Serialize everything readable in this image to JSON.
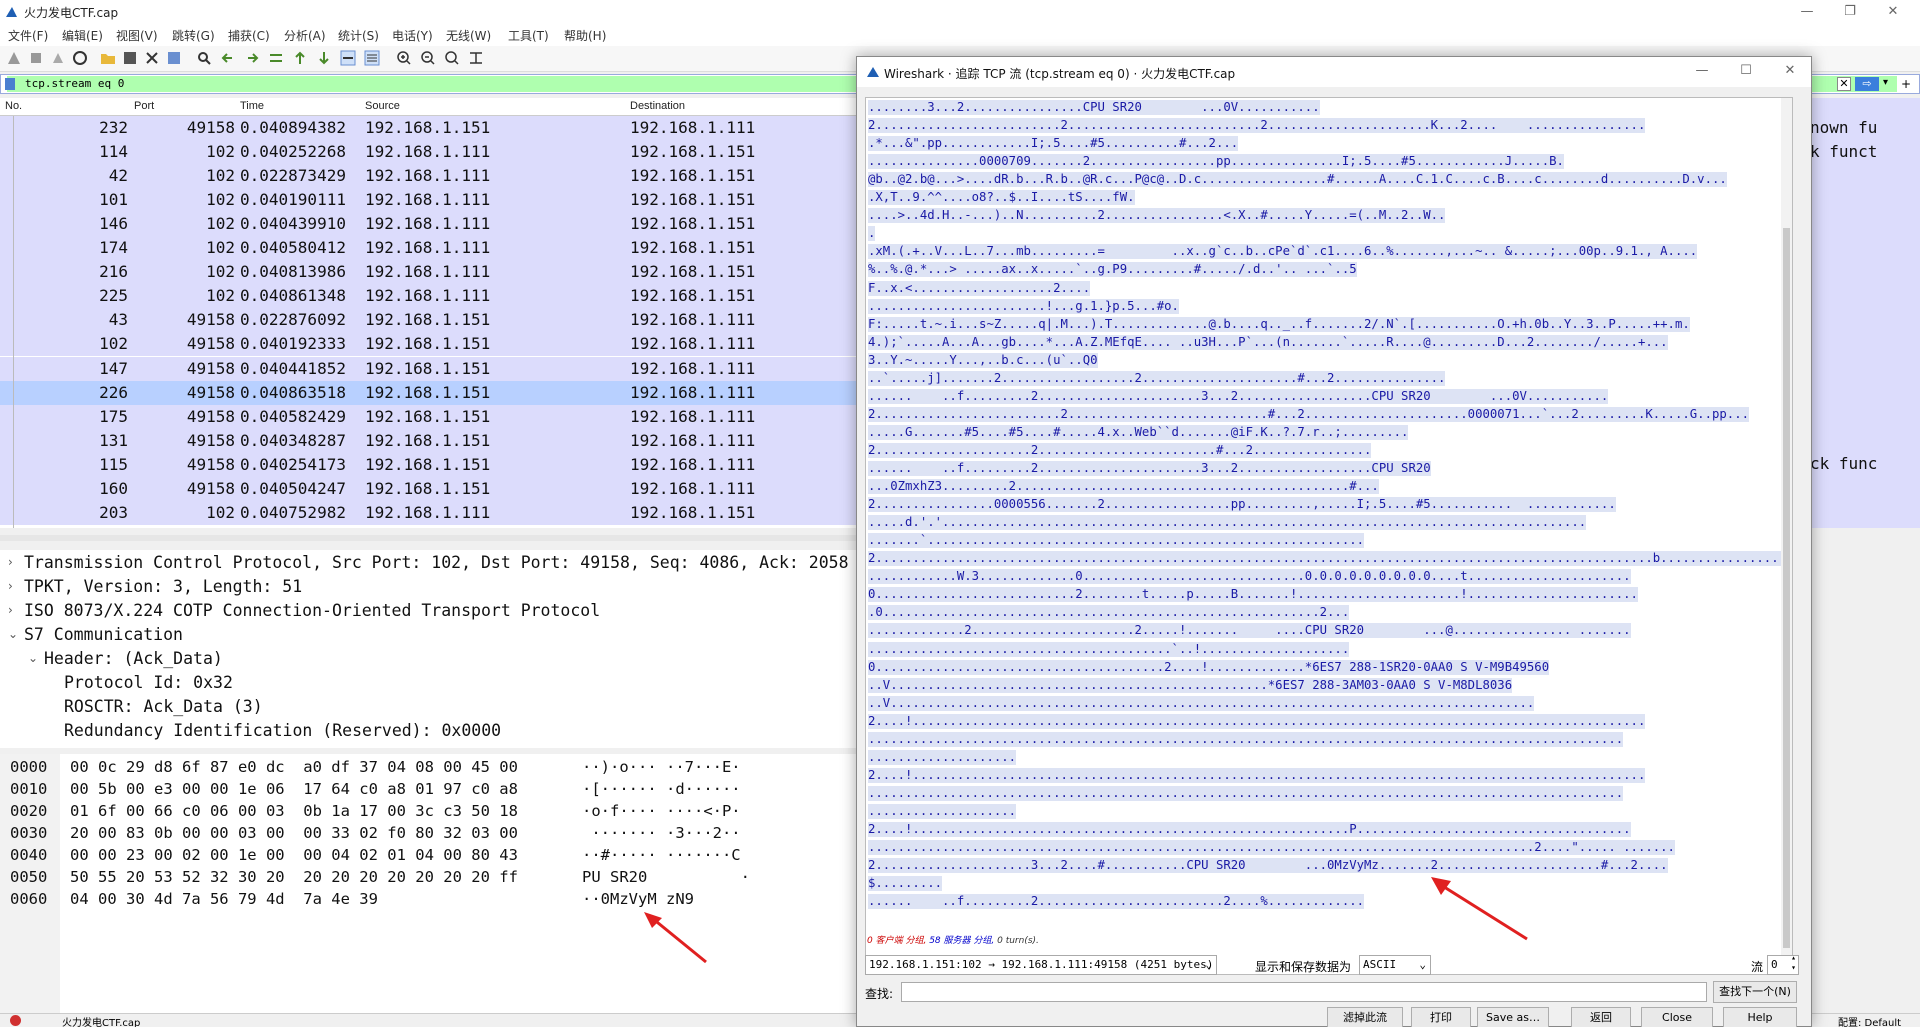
{
  "main_window": {
    "title": "火力发电CTF.cap",
    "menus": [
      "文件(F)",
      "编辑(E)",
      "视图(V)",
      "跳转(G)",
      "捕获(C)",
      "分析(A)",
      "统计(S)",
      "电话(Y)",
      "无线(W)",
      "工具(T)",
      "帮助(H)"
    ],
    "filter": "tcp.stream eq 0",
    "columns": [
      "No.",
      "Port",
      "Time",
      "Source",
      "Destination"
    ],
    "packets": [
      {
        "no": "232",
        "port": "49158",
        "time": "0.040894382",
        "src": "192.168.1.151",
        "dst": "192.168.1.111"
      },
      {
        "no": "114",
        "port": "102",
        "time": "0.040252268",
        "src": "192.168.1.111",
        "dst": "192.168.1.151"
      },
      {
        "no": "42",
        "port": "102",
        "time": "0.022873429",
        "src": "192.168.1.111",
        "dst": "192.168.1.151"
      },
      {
        "no": "101",
        "port": "102",
        "time": "0.040190111",
        "src": "192.168.1.111",
        "dst": "192.168.1.151"
      },
      {
        "no": "146",
        "port": "102",
        "time": "0.040439910",
        "src": "192.168.1.111",
        "dst": "192.168.1.151"
      },
      {
        "no": "174",
        "port": "102",
        "time": "0.040580412",
        "src": "192.168.1.111",
        "dst": "192.168.1.151"
      },
      {
        "no": "216",
        "port": "102",
        "time": "0.040813986",
        "src": "192.168.1.111",
        "dst": "192.168.1.151"
      },
      {
        "no": "225",
        "port": "102",
        "time": "0.040861348",
        "src": "192.168.1.111",
        "dst": "192.168.1.151"
      },
      {
        "no": "43",
        "port": "49158",
        "time": "0.022876092",
        "src": "192.168.1.151",
        "dst": "192.168.1.111"
      },
      {
        "no": "102",
        "port": "49158",
        "time": "0.040192333",
        "src": "192.168.1.151",
        "dst": "192.168.1.111"
      },
      {
        "no": "147",
        "port": "49158",
        "time": "0.040441852",
        "src": "192.168.1.151",
        "dst": "192.168.1.111"
      },
      {
        "no": "226",
        "port": "49158",
        "time": "0.040863518",
        "src": "192.168.1.151",
        "dst": "192.168.1.111"
      },
      {
        "no": "175",
        "port": "49158",
        "time": "0.040582429",
        "src": "192.168.1.151",
        "dst": "192.168.1.111"
      },
      {
        "no": "131",
        "port": "49158",
        "time": "0.040348287",
        "src": "192.168.1.151",
        "dst": "192.168.1.111"
      },
      {
        "no": "115",
        "port": "49158",
        "time": "0.040254173",
        "src": "192.168.1.151",
        "dst": "192.168.1.111"
      },
      {
        "no": "160",
        "port": "49158",
        "time": "0.040504247",
        "src": "192.168.1.151",
        "dst": "192.168.1.111"
      },
      {
        "no": "203",
        "port": "102",
        "time": "0.040752982",
        "src": "192.168.1.111",
        "dst": "192.168.1.151"
      }
    ],
    "selected_packet_index": 11,
    "right_fragments": [
      "nown fu",
      "k funct",
      "ck func"
    ],
    "details": [
      {
        "text": "Transmission Control Protocol, Src Port: 102, Dst Port: 49158, Seq: 4086, Ack: 2058",
        "indent": 0,
        "arrow": "›"
      },
      {
        "text": "TPKT, Version: 3, Length: 51",
        "indent": 0,
        "arrow": "›"
      },
      {
        "text": "ISO 8073/X.224 COTP Connection-Oriented Transport Protocol",
        "indent": 0,
        "arrow": "›"
      },
      {
        "text": "S7 Communication",
        "indent": 0,
        "arrow": "⌄"
      },
      {
        "text": "Header: (Ack_Data)",
        "indent": 1,
        "arrow": "⌄"
      },
      {
        "text": "Protocol Id: 0x32",
        "indent": 2,
        "arrow": ""
      },
      {
        "text": "ROSCTR: Ack_Data (3)",
        "indent": 2,
        "arrow": ""
      },
      {
        "text": "Redundancy Identification (Reserved): 0x0000",
        "indent": 2,
        "arrow": ""
      }
    ],
    "bytes": [
      {
        "offset": "0000",
        "hex": "00 0c 29 d8 6f 87 e0 dc  a0 df 37 04 08 00 45 00",
        "ascii": "··)·o··· ··7···E·"
      },
      {
        "offset": "0010",
        "hex": "00 5b 00 e3 00 00 1e 06  17 64 c0 a8 01 97 c0 a8",
        "ascii": "·[······ ·d······"
      },
      {
        "offset": "0020",
        "hex": "01 6f 00 66 c0 06 00 03  0b 1a 17 00 3c c3 50 18",
        "ascii": "·o·f···· ····<·P·"
      },
      {
        "offset": "0030",
        "hex": "20 00 83 0b 00 00 03 00  00 33 02 f0 80 32 03 00",
        "ascii": " ······· ·3···2··"
      },
      {
        "offset": "0040",
        "hex": "00 00 23 00 02 00 1e 00  00 04 02 01 04 00 80 43",
        "ascii": "··#····· ·······C"
      },
      {
        "offset": "0050",
        "hex": "50 55 20 53 52 32 30 20  20 20 20 20 20 20 20 ff",
        "ascii": "PU SR20          ·"
      },
      {
        "offset": "0060",
        "hex": "04 00 30 4d 7a 56 79 4d  7a 4e 39",
        "ascii": "··0MzVyM zN9"
      }
    ],
    "status_file": "火力发电CTF.cap",
    "status_profile": "配置: Default"
  },
  "dialog": {
    "title": "Wireshark · 追踪 TCP 流 (tcp.stream eq 0) · 火力发电CTF.cap",
    "stream_lines": [
      "........3...2................CPU SR20        ...0V...........",
      "2.........................2..........................2......................K...2....    ................",
      ".*...&\".pp............I;.5....#5..........#...2...",
      "...............0000709.......2.................pp...............I;.5....#5............J.....B.",
      "@b..@2.b@...>....dR.b...R.b..@R.c...P@c@..D.c.................#......A....C.1.C....c.B....c........d..........D.v...",
      ".X,T..9.^^....o8?..$..I....tS....fW.",
      "....>..4d.H..-...)..N..........2................<.X..#.....Y.....=(..M..2..W..",
      ".",
      ".xM.(.+..V...L..7...mb.........=         ..x..g`c..b..cPe`d`.c1....6..%.......,...~.. &.....;...00p..9.1., A....",
      "%..%.@.*...> .....ax..x.....`..g.P9.........#...../.d..'.. ...`..5",
      "F..x.<...................2....",
      "........................!...g.1.}p.5...#o.",
      "F:.....t.~.i...s~Z.....q|.M...).T.............@.b....q.._..f.......2/.N`.[...........O.+h.0b..Y..3..P.....++.m.",
      "4.);`.....A...A...gb....*...A.Z.MEfqE.... ..u3H...P`...(n.......`.....R....@.........D...2......../.....+...",
      "3..Y.~.....Y...,..b.c...(u`..Q0",
      "..`.....j].......2..................2.....................#...2...............",
      "......    ..f.........2......................3...2..................CPU SR20        ...0V...........",
      "2.........................2...........................#...2......................0000071...`...2.........K.....G..pp...",
      ".....G.......#5....#5....#.....4.x..Web``d.......@iF.K..?.7.r..;.........",
      "2.....................2........................#...2................",
      "......    ..f.........2......................3...2..................CPU SR20",
      "...0ZmxhZ3.........2.............................................#...",
      "2................0000556.......2.................pp.........,.....I;.5....#5...........  ............",
      ".....d.'.'.......................................................................................",
      ".......`...........................................................",
      "2.........................................................................................................b....................",
      "............W.3.............0..............................0.0.0.0.0.0.0.0.0....t......................",
      "0...........................2........t.....p.....B.......!......................!.......................",
      ".0...........................................................2...",
      ".............2......................2.....!.......     ....CPU SR20        ...@................ .......",
      ".........................................`..!....................",
      "0.......................................2....!.............*6ES7 288-1SR20-0AA0 S V-M9B49560",
      "..V...................................................*6ES7 288-3AM03-0AA0 S V-M8DL8036",
      "..V.......................................................................................",
      "2....!...................................................................................................",
      "......................................................................................................",
      "....................",
      "2....!...................................................................................................",
      "......................................................................................................",
      "....................",
      "2....!...........................................................P.....................................",
      "..........................................................................................2....\"..... .......",
      "2.....................3...2....#...........CPU SR20        ...0MzVyMz.......2......................#...2....",
      "$.........",
      "......    ..f.........2.........................2....%............."
    ],
    "summary_client": "0 客户端 分组,",
    "summary_server": "58 服务器 分组,",
    "summary_turns": "0 turn(s).",
    "stream_select": "192.168.1.151:102 → 192.168.1.111:49158 (4251 bytes)",
    "show_as_label": "显示和保存数据为",
    "show_as_value": "ASCII",
    "stream_label": "流",
    "stream_number": "0",
    "find_label": "查找:",
    "find_value": "",
    "find_next_button": "查找下一个(N)",
    "buttons": [
      "滤掉此流",
      "打印",
      "Save as…",
      "返回",
      "Close",
      "Help"
    ]
  }
}
